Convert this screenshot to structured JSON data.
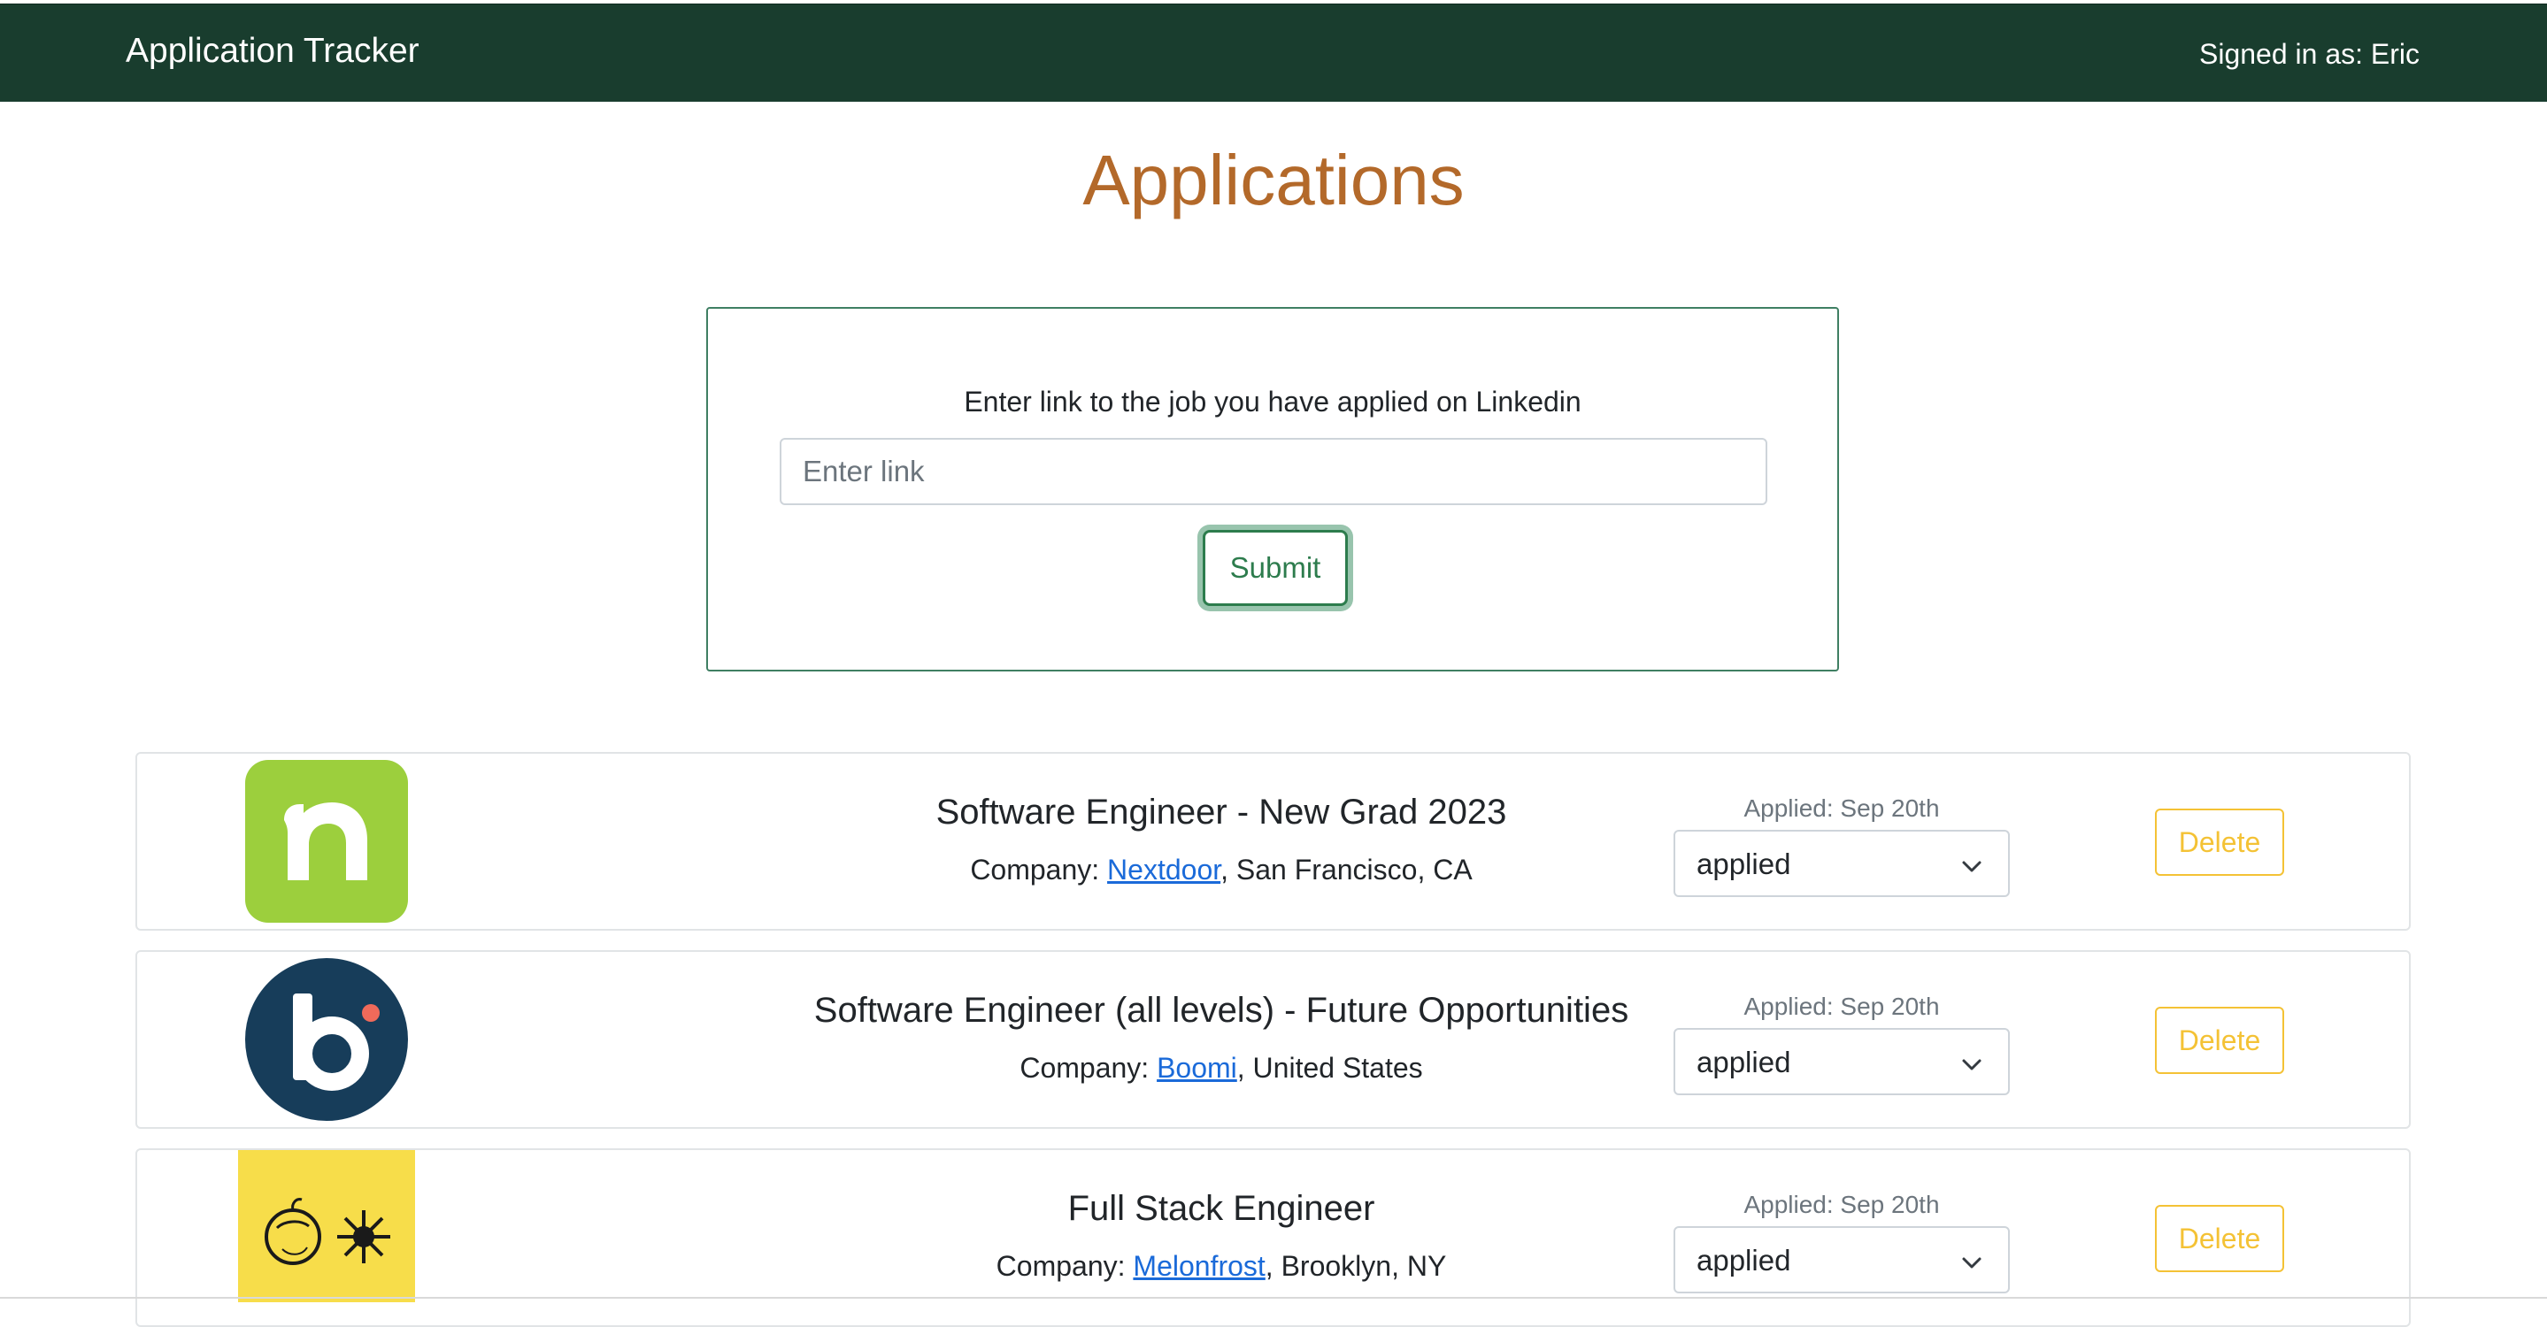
{
  "navbar": {
    "brand": "Application Tracker",
    "signed_in": "Signed in as: Eric"
  },
  "page": {
    "title": "Applications"
  },
  "link_form": {
    "prompt": "Enter link to the job you have applied on Linkedin",
    "input_value": "",
    "input_placeholder": "Enter link",
    "submit_label": "Submit"
  },
  "applications": [
    {
      "title": "Software Engineer - New Grad 2023",
      "company_prefix": "Company: ",
      "company": "Nextdoor",
      "location": ", San Francisco, CA",
      "applied": "Applied: Sep 20th",
      "status": "applied",
      "delete_label": "Delete",
      "logo_icon": "nextdoor-logo"
    },
    {
      "title": "Software Engineer (all levels) - Future Opportunities",
      "company_prefix": "Company: ",
      "company": "Boomi",
      "location": ", United States",
      "applied": "Applied: Sep 20th",
      "status": "applied",
      "delete_label": "Delete",
      "logo_icon": "boomi-logo"
    },
    {
      "title": "Full Stack Engineer",
      "company_prefix": "Company: ",
      "company": "Melonfrost",
      "location": ", Brooklyn, NY",
      "applied": "Applied: Sep 20th",
      "status": "applied",
      "delete_label": "Delete",
      "logo_icon": "melonfrost-logo"
    }
  ],
  "colors": {
    "navbar_bg": "#193d2e",
    "title": "#b3692a",
    "submit": "#2d7c4d",
    "delete": "#f4c235",
    "link": "#1a6ad9"
  }
}
